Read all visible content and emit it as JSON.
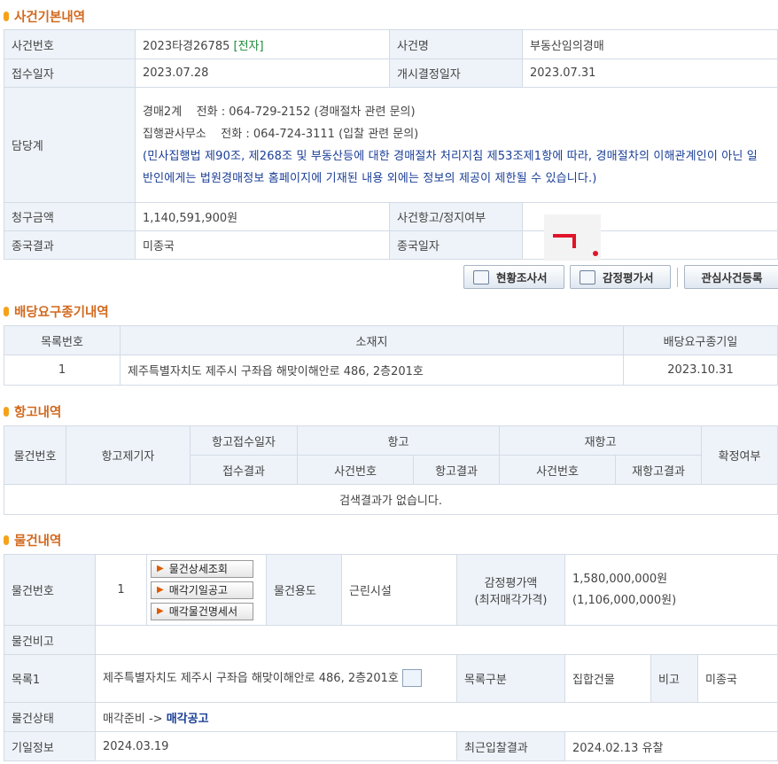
{
  "case_basic": {
    "title": "사건기본내역",
    "case_no_label": "사건번호",
    "case_no": "2023타경26785",
    "case_tag": "[전자]",
    "case_name_label": "사건명",
    "case_name": "부동산임의경매",
    "receipt_label": "접수일자",
    "receipt": "2023.07.28",
    "start_label": "개시결정일자",
    "start": "2023.07.31",
    "charge_label": "담당계",
    "charge_line1": "경매2계    전화 : 064-729-2152 (경매절차 관련 문의)",
    "charge_line2": "집행관사무소    전화 : 064-724-3111 (입찰 관련 문의)",
    "charge_notice": "(민사집행법 제90조, 제268조 및 부동산등에 대한 경매절차 처리지침 제53조제1항에 따라, 경매절차의 이해관계인이 아닌 일반인에게는 법원경매정보 홈페이지에 기재된 내용 외에는 정보의 제공이 제한될 수 있습니다.)",
    "claim_label": "청구금액",
    "claim": "1,140,591,900원",
    "appeal_label": "사건항고/정지여부",
    "appeal": "",
    "final_label": "종국결과",
    "final": "미종국",
    "final_date_label": "종국일자",
    "final_date": ""
  },
  "buttons": {
    "survey": "현황조사서",
    "appraisal": "감정평가서",
    "interest": "관심사건등록"
  },
  "dividend": {
    "title": "배당요구종기내역",
    "headers": [
      "목록번호",
      "소재지",
      "배당요구종기일"
    ],
    "row": {
      "no": "1",
      "address": "제주특별자치도 제주시 구좌읍 해맞이해안로 486, 2층201호",
      "date": "2023.10.31"
    }
  },
  "appeal": {
    "title": "항고내역",
    "h_item_no": "물건번호",
    "h_appellant": "항고제기자",
    "h_receipt_date": "항고접수일자",
    "h_appeal": "항고",
    "h_reappeal": "재항고",
    "h_confirmed": "확정여부",
    "h_receipt_result": "접수결과",
    "h_case_no": "사건번호",
    "h_appeal_result": "항고결과",
    "h_case_no2": "사건번호",
    "h_reappeal_result": "재항고결과",
    "empty": "검색결과가 없습니다."
  },
  "item": {
    "title": "물건내역",
    "no_label": "물건번호",
    "no": "1",
    "btn_detail": "물건상세조회",
    "btn_notice": "매각기일공고",
    "btn_spec": "매각물건명세서",
    "use_label": "물건용도",
    "use": "근린시설",
    "appraisal_label1": "감정평가액",
    "appraisal_label2": "(최저매각가격)",
    "appraisal": "1,580,000,000원",
    "min_price": "(1,106,000,000원)",
    "remark_label": "물건비고",
    "remark": "",
    "list1_label": "목록1",
    "list1": "제주특별자치도 제주시 구좌읍 해맞이해안로 486, 2층201호",
    "list_type_label": "목록구분",
    "list_type": "집합건물",
    "note_label": "비고",
    "note": "미종국",
    "status_label": "물건상태",
    "status_prefix": "매각준비 ->",
    "status_link": "매각공고",
    "date_label": "기일정보",
    "date": "2024.03.19",
    "recent_label": "최근입찰결과",
    "recent": "2024.02.13 유찰"
  }
}
